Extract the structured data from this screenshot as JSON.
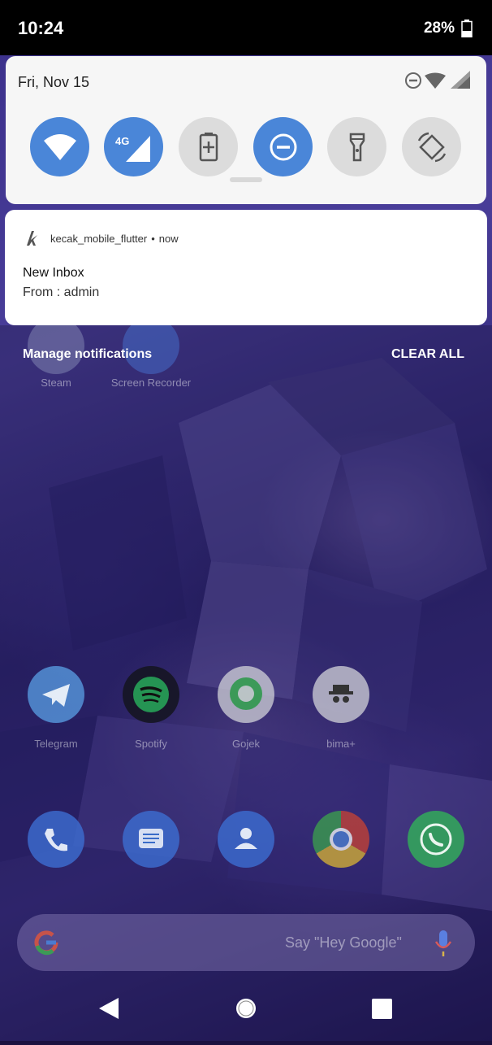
{
  "status_bar": {
    "time": "10:24",
    "battery": "28%"
  },
  "quick_settings": {
    "date": "Fri, Nov 15",
    "tiles": [
      {
        "name": "wifi",
        "state": "on"
      },
      {
        "name": "mobile-data",
        "label": "4G",
        "state": "on"
      },
      {
        "name": "battery-saver",
        "state": "off"
      },
      {
        "name": "do-not-disturb",
        "state": "on"
      },
      {
        "name": "flashlight",
        "state": "off"
      },
      {
        "name": "auto-rotate",
        "state": "off"
      }
    ]
  },
  "notification": {
    "app_name": "kecak_mobile_flutter",
    "separator": "•",
    "time": "now",
    "title": "New Inbox",
    "body": "From : admin"
  },
  "actions": {
    "manage": "Manage notifications",
    "clear_all": "CLEAR ALL"
  },
  "home": {
    "row1": [
      {
        "label": "Steam"
      },
      {
        "label": "Screen Recorder"
      }
    ],
    "row2": [
      {
        "label": "Telegram"
      },
      {
        "label": "Spotify"
      },
      {
        "label": "Gojek"
      },
      {
        "label": "bima+"
      }
    ],
    "dock": [
      "phone",
      "messages",
      "contacts",
      "chrome",
      "whatsapp"
    ]
  },
  "search": {
    "placeholder": "Say \"Hey Google\""
  },
  "colors": {
    "tile_on": "#4a86d8",
    "tile_off": "#dcdcdc",
    "accent": "#4a86d8"
  }
}
